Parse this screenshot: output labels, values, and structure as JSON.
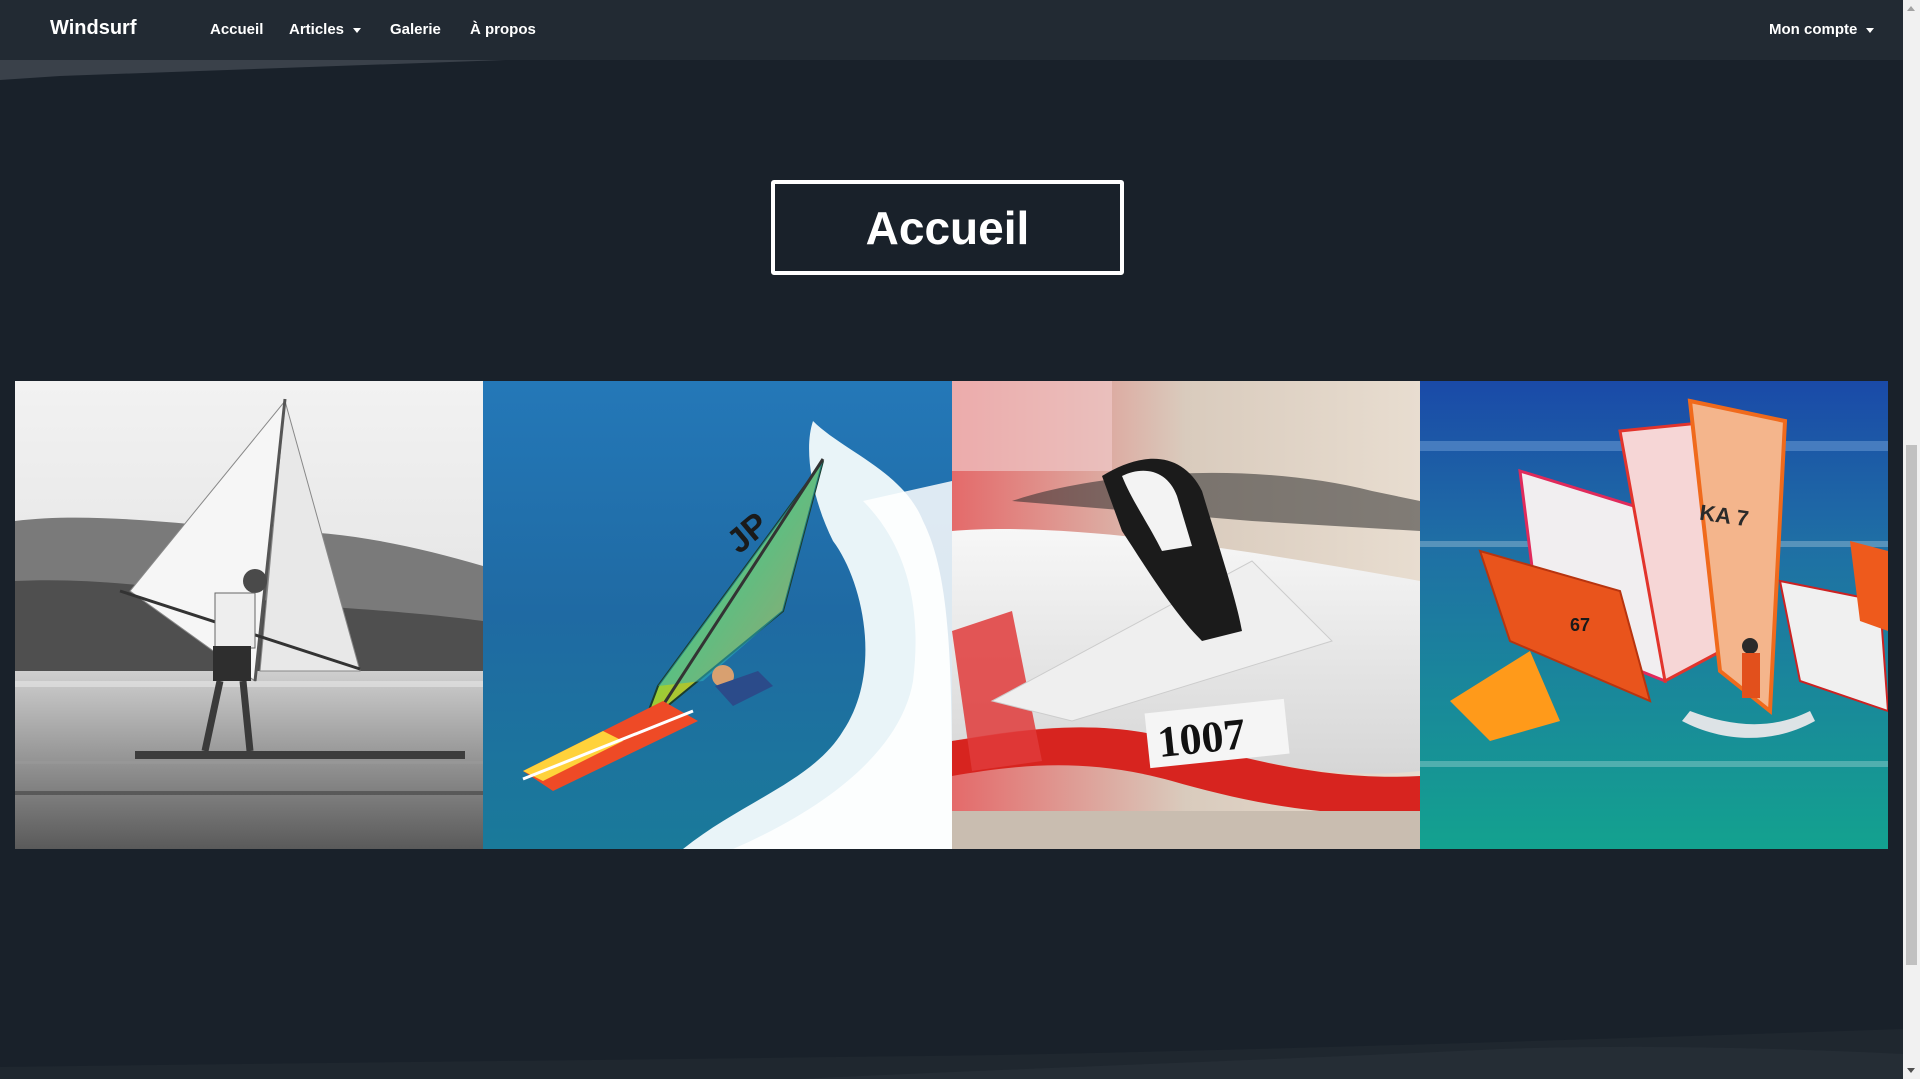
{
  "navbar": {
    "brand": "Windsurf",
    "links": [
      {
        "label": "Accueil",
        "dropdown": false
      },
      {
        "label": "Articles",
        "dropdown": true
      },
      {
        "label": "Galerie",
        "dropdown": false
      },
      {
        "label": "À propos",
        "dropdown": false
      }
    ],
    "account": {
      "label": "Mon compte",
      "dropdown": true
    }
  },
  "hero": {
    "title": "Accueil"
  },
  "gallery": [
    {
      "name": "vintage-windsurfer-photo"
    },
    {
      "name": "jp-windsurf-wave-photo"
    },
    {
      "name": "board-footstrap-photo"
    },
    {
      "name": "windsurf-race-photo"
    }
  ],
  "colors": {
    "background": "#19212a",
    "navbar": "#222a33",
    "text": "#ffffff"
  }
}
